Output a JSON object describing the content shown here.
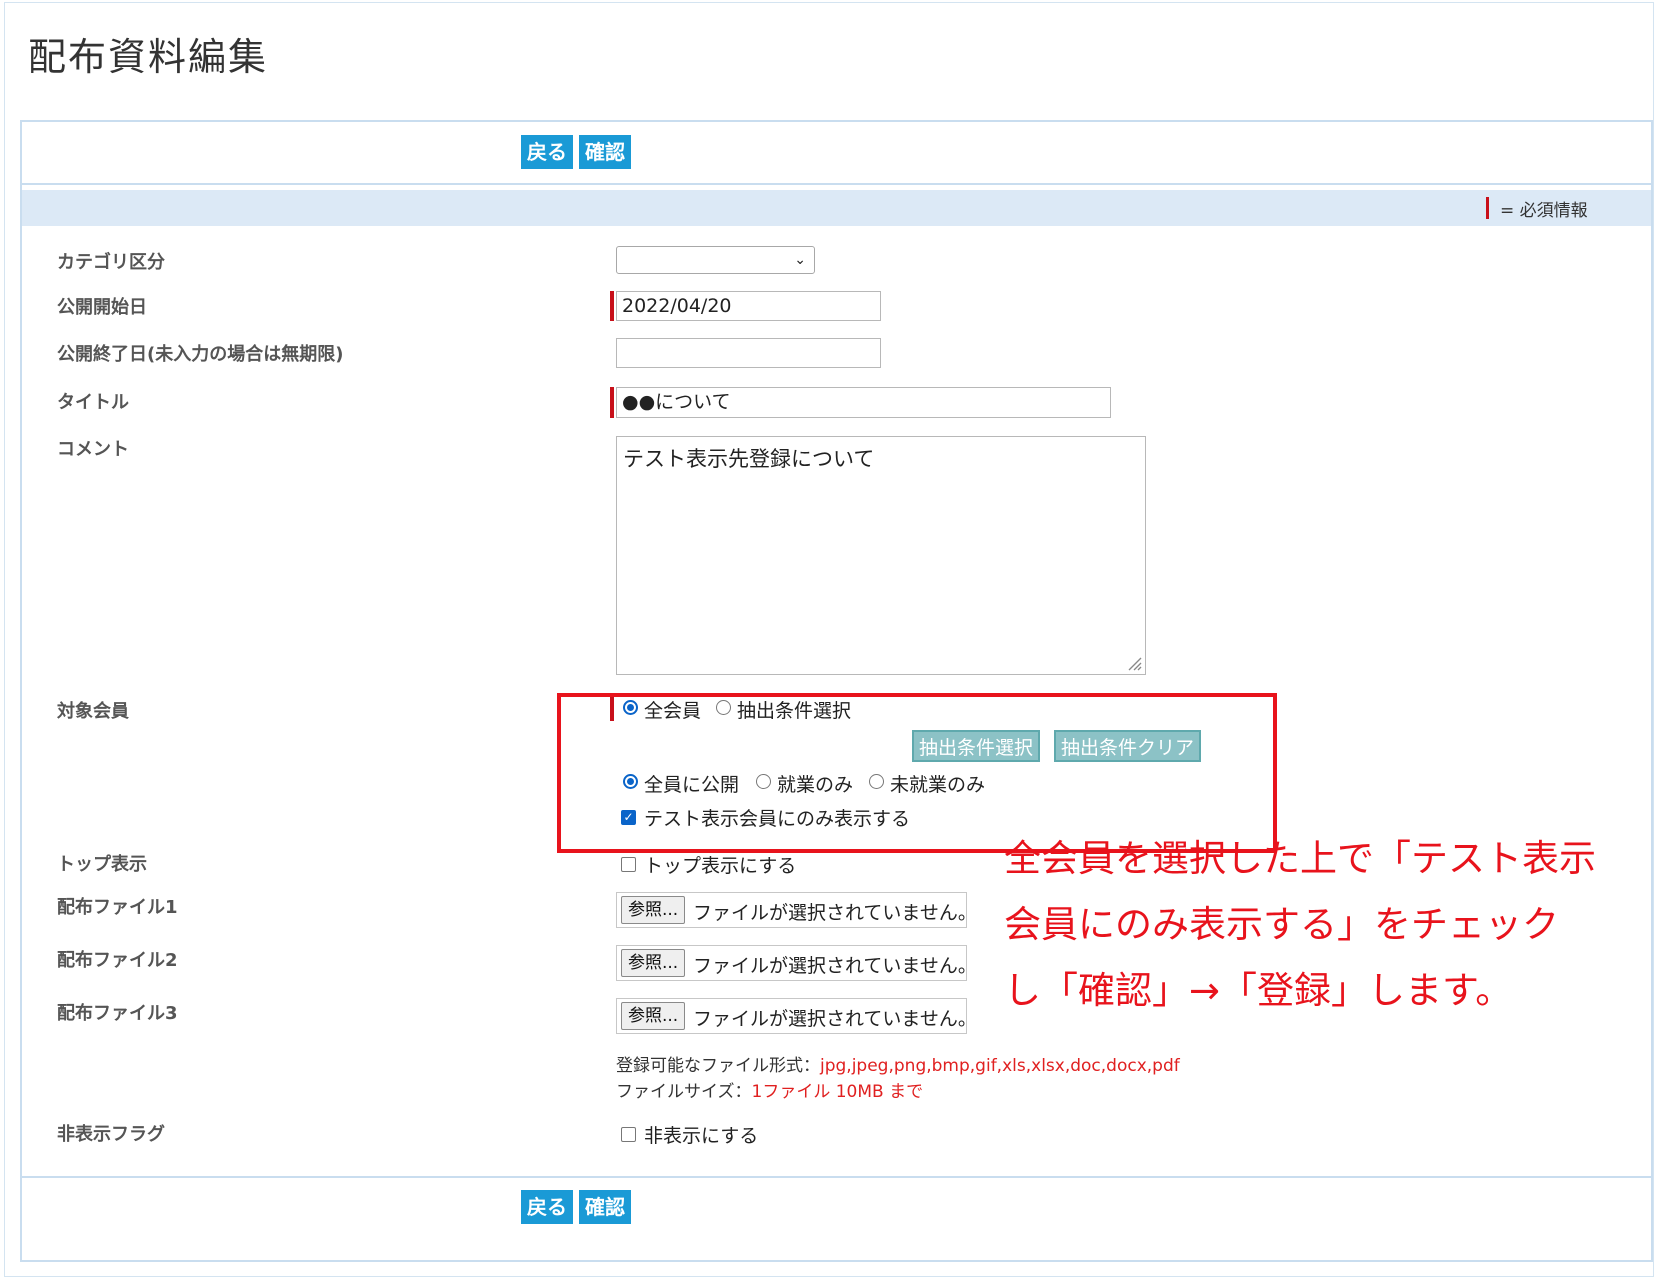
{
  "page": {
    "title": "配布資料編集"
  },
  "toolbar": {
    "back_label": "戻る",
    "confirm_label": "確認"
  },
  "legend": {
    "text": "= 必須情報"
  },
  "form": {
    "category": {
      "label": "カテゴリ区分",
      "value": ""
    },
    "start_date": {
      "label": "公開開始日",
      "value": "2022/04/20"
    },
    "end_date": {
      "label": "公開終了日(未入力の場合は無期限)",
      "value": ""
    },
    "title": {
      "label": "タイトル",
      "value": "●●について"
    },
    "comment": {
      "label": "コメント",
      "value": "テスト表示先登録について"
    },
    "target": {
      "label": "対象会員",
      "opt_all": "全会員",
      "opt_extract": "抽出条件選択",
      "btn_select": "抽出条件選択",
      "btn_clear": "抽出条件クリア",
      "pub_all": "全員に公開",
      "pub_employed": "就業のみ",
      "pub_unemployed": "未就業のみ",
      "test_only": "テスト表示会員にのみ表示する"
    },
    "top_display": {
      "label": "トップ表示",
      "option": "トップ表示にする"
    },
    "files": [
      {
        "label": "配布ファイル1",
        "button": "参照...",
        "status": "ファイルが選択されていません。"
      },
      {
        "label": "配布ファイル2",
        "button": "参照...",
        "status": "ファイルが選択されていません。"
      },
      {
        "label": "配布ファイル3",
        "button": "参照...",
        "status": "ファイルが選択されていません。"
      }
    ],
    "file_info": {
      "formats_label": "登録可能なファイル形式：",
      "formats_value": "jpg,jpeg,png,bmp,gif,xls,xlsx,doc,docx,pdf",
      "size_label": "ファイルサイズ：",
      "size_value": "1ファイル 10MB まで"
    },
    "hidden_flag": {
      "label": "非表示フラグ",
      "option": "非表示にする"
    }
  },
  "annotation": {
    "line1": "全会員を選択した上で「テスト表示",
    "line2": "会員にのみ表示する」をチェック",
    "line3": "し「確認」→「登録」します。"
  },
  "colors": {
    "accent": "#1a9ad6",
    "required": "#c8101a",
    "highlight": "#e8131c",
    "disabled_btn": "#8cc2c6"
  }
}
